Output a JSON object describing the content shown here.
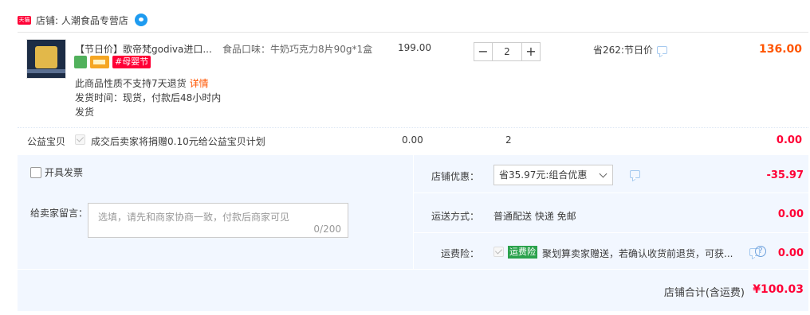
{
  "shop": {
    "badge": "天猫",
    "name": "店铺: 人潮食品专营店"
  },
  "item": {
    "title": "【节日价】歌帝梵godiva进口...",
    "festival_badge": "#母婴节",
    "flavor": "食品口味：牛奶巧克力8片90g*1盒",
    "unit_price": "199.00",
    "quantity": "2",
    "minus": "−",
    "plus": "+",
    "promo": "省262:节日价",
    "total": "136.00",
    "no_return": "此商品性质不支持7天退货",
    "detail_link": "详情",
    "ship_time": "发货时间：现货，付款后48小时内发货"
  },
  "charity": {
    "label": "公益宝贝",
    "text": "成交后卖家将捐赠0.10元给公益宝贝计划",
    "price": "0.00",
    "qty": "2",
    "total": "0.00"
  },
  "invoice": {
    "label": "开具发票"
  },
  "memo": {
    "label": "给卖家留言：",
    "placeholder": "选填，请先和商家协商一致，付款后商家可见",
    "count": "0/200"
  },
  "discount": {
    "label": "店铺优惠：",
    "selected": "省35.97元:组合优惠",
    "amount": "-35.97"
  },
  "shipping": {
    "label": "运送方式：",
    "value": "普通配送 快递 免邮",
    "amount": "0.00"
  },
  "insurance": {
    "label": "运费险：",
    "badge": "运费险",
    "text": "聚划算卖家赠送，若确认收货前退货，可获...",
    "help": "?",
    "amount": "0.00"
  },
  "summary": {
    "label": "店铺合计(含运费)",
    "value": "¥100.03"
  }
}
